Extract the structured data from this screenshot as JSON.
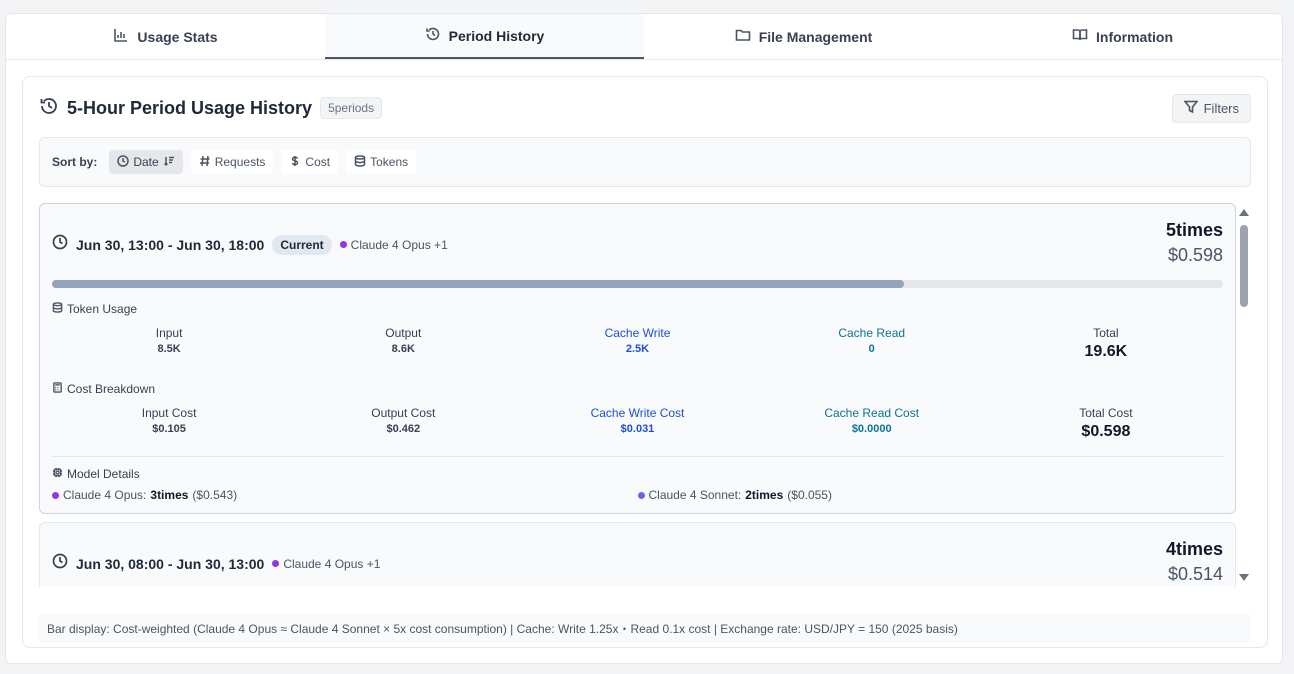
{
  "tabs": [
    {
      "label": "Usage Stats",
      "icon": "bar-chart-icon"
    },
    {
      "label": "Period History",
      "icon": "history-icon",
      "active": true
    },
    {
      "label": "File Management",
      "icon": "folder-icon"
    },
    {
      "label": "Information",
      "icon": "book-icon"
    }
  ],
  "history": {
    "title": "5-Hour Period Usage History",
    "count_badge": "5periods",
    "filters_label": "Filters"
  },
  "sort": {
    "label": "Sort by:",
    "options": [
      {
        "label": "Date",
        "icon": "clock-icon",
        "active": true
      },
      {
        "label": "Requests",
        "icon": "hash-icon"
      },
      {
        "label": "Cost",
        "icon": "dollar-icon"
      },
      {
        "label": "Tokens",
        "icon": "database-icon"
      }
    ]
  },
  "periods": [
    {
      "range": "Jun 30, 13:00 - Jun 30, 18:00",
      "badge": "Current",
      "model_tag": "Claude 4 Opus +1",
      "times": "5times",
      "cost": "$0.598",
      "bar_fraction": 0.728,
      "token_usage": {
        "title": "Token Usage",
        "input_label": "Input",
        "input": "8.5K",
        "output_label": "Output",
        "output": "8.6K",
        "cache_write_label": "Cache Write",
        "cache_write": "2.5K",
        "cache_read_label": "Cache Read",
        "cache_read": "0",
        "total_label": "Total",
        "total": "19.6K"
      },
      "cost_breakdown": {
        "title": "Cost Breakdown",
        "input_label": "Input Cost",
        "input": "$0.105",
        "output_label": "Output Cost",
        "output": "$0.462",
        "cache_write_label": "Cache Write Cost",
        "cache_write": "$0.031",
        "cache_read_label": "Cache Read Cost",
        "cache_read": "$0.0000",
        "total_label": "Total Cost",
        "total": "$0.598"
      },
      "model_details": {
        "title": "Model Details",
        "models": [
          {
            "name": "Claude 4 Opus:",
            "times": "3times",
            "cost": "($0.543)",
            "color": "#9333ea"
          },
          {
            "name": "Claude 4 Sonnet:",
            "times": "2times",
            "cost": "($0.055)",
            "color": "#6366f1"
          }
        ]
      }
    },
    {
      "range": "Jun 30, 08:00 - Jun 30, 13:00",
      "model_tag": "Claude 4 Opus +1",
      "times": "4times",
      "cost": "$0.514"
    }
  ],
  "footer": "Bar display: Cost-weighted (Claude 4 Opus ≈ Claude 4 Sonnet × 5x cost consumption) | Cache: Write 1.25x・Read 0.1x cost | Exchange rate: USD/JPY = 150 (2025 basis)"
}
